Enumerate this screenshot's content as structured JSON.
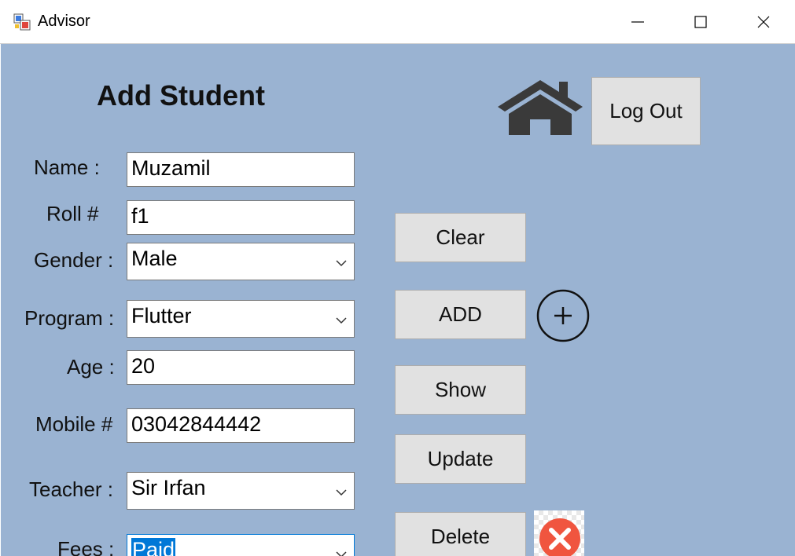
{
  "window": {
    "title": "Advisor",
    "controls": [
      "minimize",
      "maximize",
      "close"
    ]
  },
  "form": {
    "heading": "Add Student",
    "fields": {
      "name": {
        "label": "Name :",
        "value": "Muzamil"
      },
      "roll": {
        "label": "Roll #",
        "value": "f1"
      },
      "gender": {
        "label": "Gender :",
        "value": "Male"
      },
      "program": {
        "label": "Program :",
        "value": "Flutter"
      },
      "age": {
        "label": "Age :",
        "value": "20"
      },
      "mobile": {
        "label": "Mobile #",
        "value": "03042844442"
      },
      "teacher": {
        "label": "Teacher :",
        "value": "Sir Irfan"
      },
      "fees": {
        "label": "Fees :",
        "value": "Paid"
      }
    }
  },
  "buttons": {
    "logout": "Log Out",
    "clear": "Clear",
    "add": "ADD",
    "show": "Show",
    "update": "Update",
    "delete": "Delete"
  },
  "icons": {
    "home": "home-icon",
    "add": "plus-circle-icon",
    "delete": "red-x-icon"
  },
  "colors": {
    "background": "#9ab3d2",
    "button": "#e1e1e1",
    "selection": "#0078d7",
    "delete_icon": "#f0553f"
  }
}
